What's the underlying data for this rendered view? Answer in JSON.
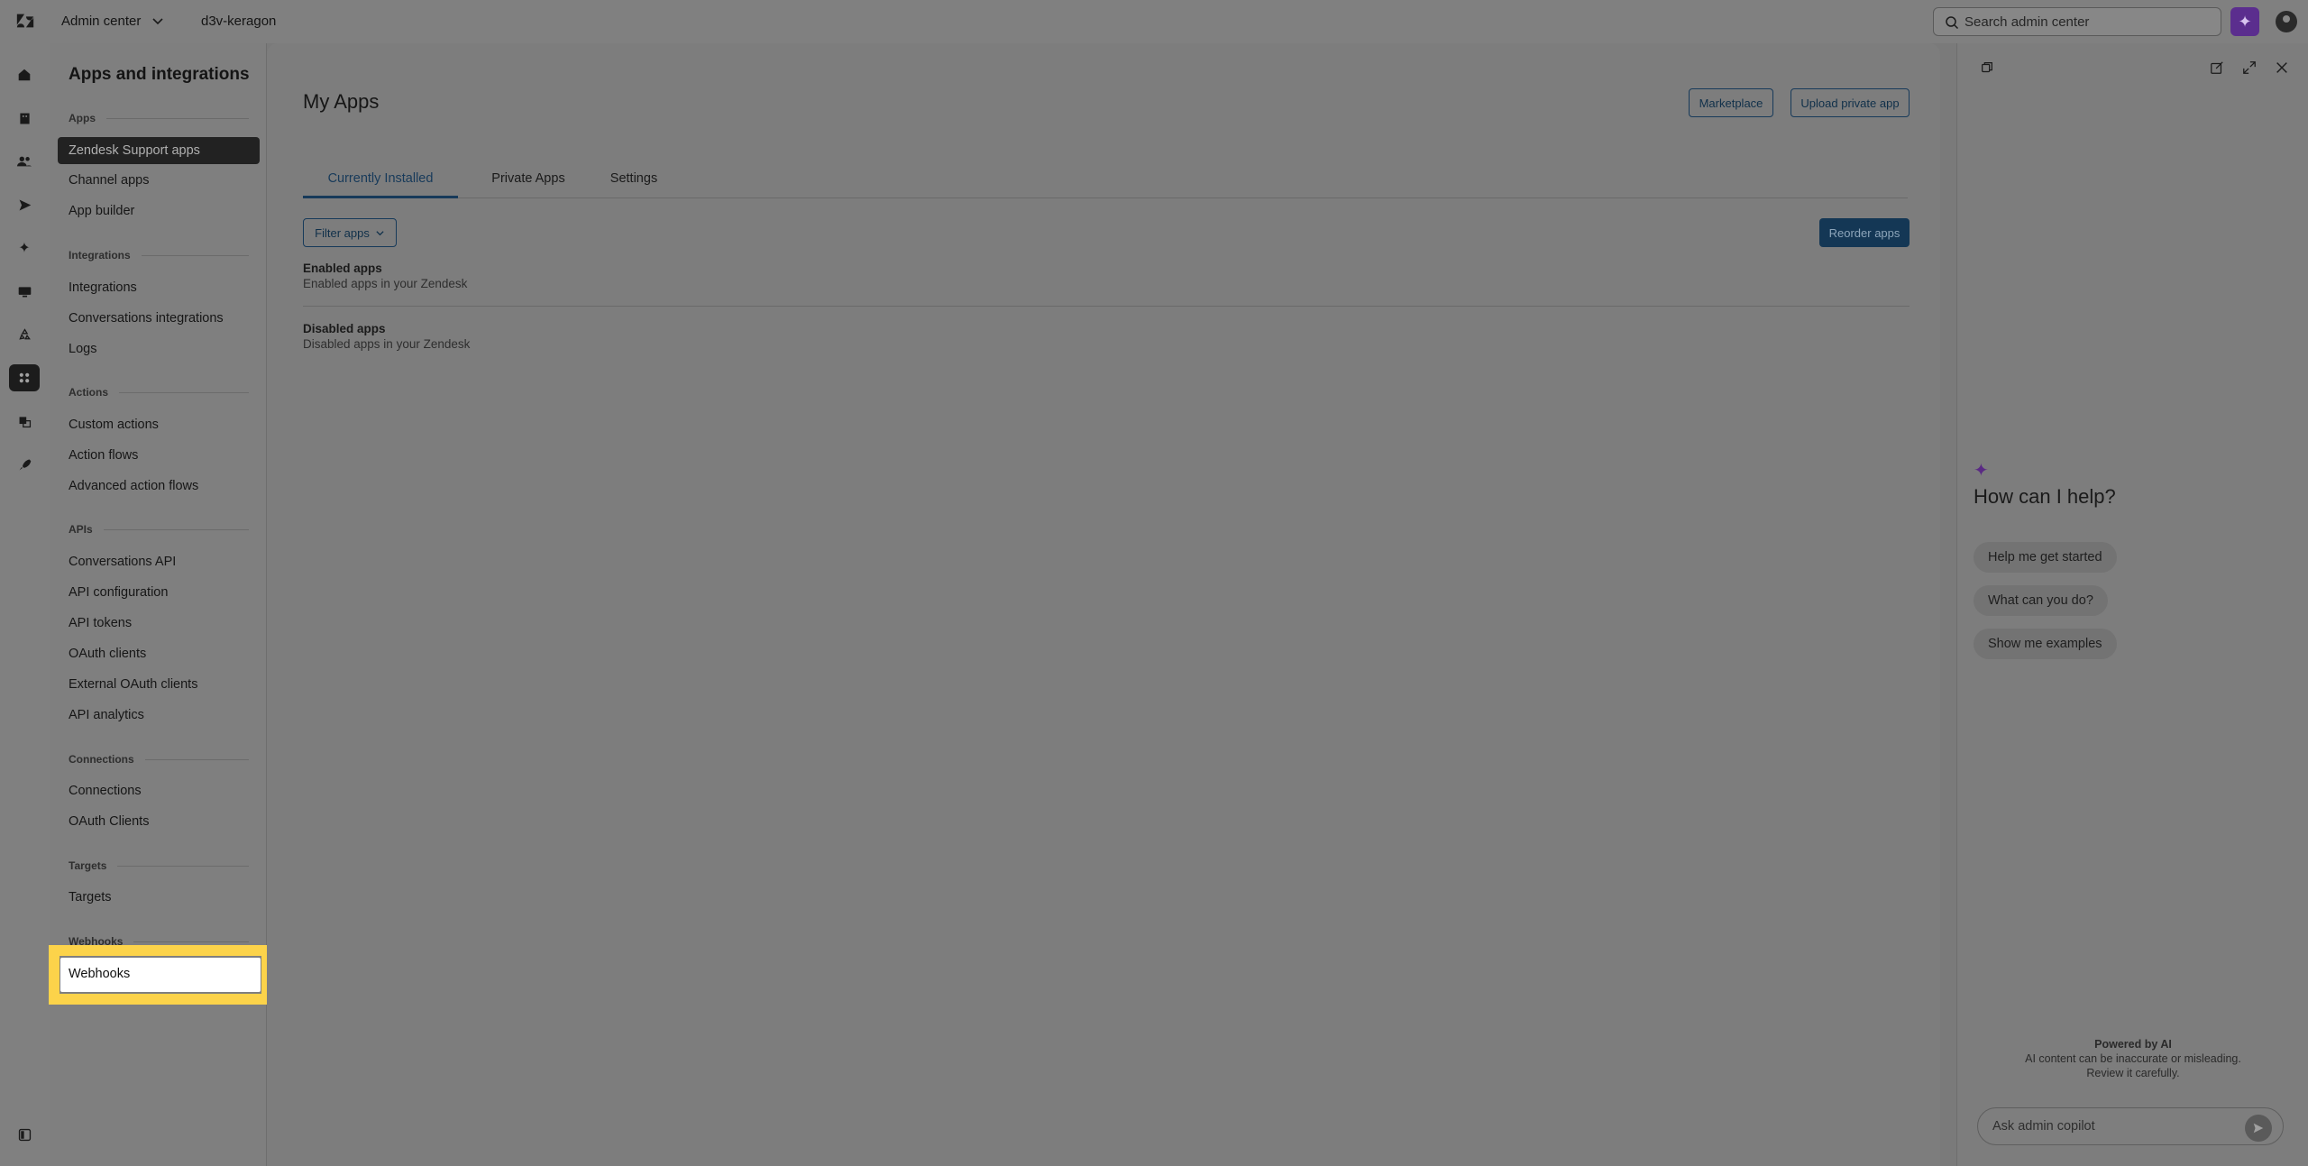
{
  "topbar": {
    "product_name": "Admin center",
    "account_name": "d3v-keragon",
    "search_placeholder": "Search admin center"
  },
  "rail": {
    "icons": [
      "home-icon",
      "building-icon",
      "people-icon",
      "send-icon",
      "sparkle-icon",
      "monitor-icon",
      "recycle-icon",
      "apps-icon",
      "objects-icon",
      "rocket-icon",
      "panel-toggle-icon"
    ]
  },
  "sidebar": {
    "title": "Apps and integrations",
    "sections": {
      "apps": {
        "header": "Apps",
        "items": [
          "Zendesk Support apps",
          "Channel apps",
          "App builder"
        ]
      },
      "integrations": {
        "header": "Integrations",
        "items": [
          "Integrations",
          "Conversations integrations",
          "Logs"
        ]
      },
      "actions": {
        "header": "Actions",
        "items": [
          "Custom actions",
          "Action flows",
          "Advanced action flows"
        ]
      },
      "apis": {
        "header": "APIs",
        "items": [
          "Conversations API",
          "API configuration",
          "API tokens",
          "OAuth clients",
          "External OAuth clients",
          "API analytics"
        ]
      },
      "connections": {
        "header": "Connections",
        "items": [
          "Connections",
          "OAuth Clients"
        ]
      },
      "targets": {
        "header": "Targets",
        "items": [
          "Targets"
        ]
      },
      "webhooks": {
        "header": "Webhooks",
        "items": [
          "Webhooks"
        ]
      }
    },
    "selected": "Zendesk Support apps",
    "highlighted": "Webhooks"
  },
  "main": {
    "title": "My Apps",
    "marketplace_label": "Marketplace",
    "upload_label": "Upload private app",
    "tabs": [
      {
        "label": "Currently Installed",
        "active": true
      },
      {
        "label": "Private Apps",
        "active": false
      },
      {
        "label": "Settings",
        "active": false
      }
    ],
    "filter_label": "Filter apps",
    "reorder_label": "Reorder apps",
    "enabled": {
      "title": "Enabled apps",
      "subtitle": "Enabled apps in your Zendesk"
    },
    "disabled": {
      "title": "Disabled apps",
      "subtitle": "Disabled apps in your Zendesk"
    }
  },
  "copilot": {
    "heading": "How can I help?",
    "suggestions": [
      "Help me get started",
      "What can you do?",
      "Show me examples"
    ],
    "powered_by": "Powered by AI",
    "disclaimer_1": "AI content can be inaccurate or misleading.",
    "disclaimer_2": "Review it carefully.",
    "input_placeholder": "Ask admin copilot"
  },
  "colors": {
    "highlight": "#fcd34a",
    "primary": "#143755",
    "copilot_brand": "#5b2e8e"
  }
}
